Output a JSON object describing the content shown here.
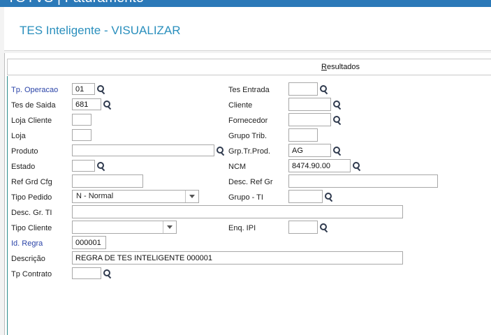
{
  "app": {
    "top_title": "TOTVS | Faturamento"
  },
  "header": {
    "title": "TES Inteligente - VISUALIZAR"
  },
  "results": {
    "prefix": "",
    "underlined": "R",
    "rest": "esultados"
  },
  "form": {
    "tp_operacao": {
      "label": "Tp. Operacao",
      "value": "01"
    },
    "tes_saida": {
      "label": "Tes de Saida",
      "value": "681"
    },
    "loja_cliente": {
      "label": "Loja Cliente",
      "value": ""
    },
    "loja": {
      "label": "Loja",
      "value": ""
    },
    "produto": {
      "label": "Produto",
      "value": ""
    },
    "estado": {
      "label": "Estado",
      "value": ""
    },
    "ref_grd_cfg": {
      "label": "Ref Grd Cfg",
      "value": ""
    },
    "tipo_pedido": {
      "label": "Tipo Pedido",
      "value": "N - Normal"
    },
    "desc_gr_ti": {
      "label": "Desc. Gr. TI",
      "value": ""
    },
    "tipo_cliente": {
      "label": "Tipo Cliente",
      "value": ""
    },
    "id_regra": {
      "label": "Id. Regra",
      "value": "000001"
    },
    "descricao": {
      "label": "Descrição",
      "value": "REGRA DE TES INTELIGENTE 000001"
    },
    "tp_contrato": {
      "label": "Tp Contrato",
      "value": ""
    },
    "tes_entrada": {
      "label": "Tes Entrada",
      "value": ""
    },
    "cliente": {
      "label": "Cliente",
      "value": ""
    },
    "fornecedor": {
      "label": "Fornecedor",
      "value": ""
    },
    "grupo_trib": {
      "label": "Grupo Trib.",
      "value": ""
    },
    "grp_tr_prod": {
      "label": "Grp.Tr.Prod.",
      "value": "AG"
    },
    "ncm": {
      "label": "NCM",
      "value": "8474.90.00"
    },
    "desc_ref_gr": {
      "label": "Desc. Ref Gr",
      "value": ""
    },
    "grupo_ti": {
      "label": "Grupo - TI",
      "value": ""
    },
    "enq_ipi": {
      "label": "Enq. IPI",
      "value": ""
    }
  },
  "colors": {
    "accent": "#2a8fbd",
    "topbar": "#2b79b8",
    "required_label": "#2b44a8"
  }
}
